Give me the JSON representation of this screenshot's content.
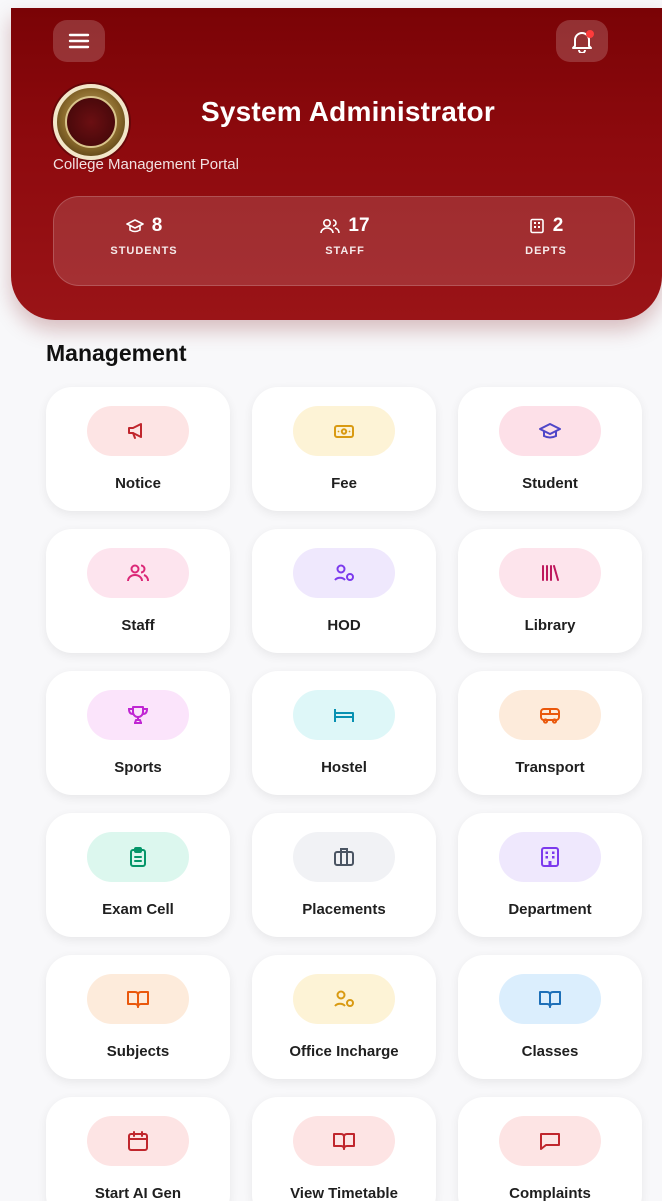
{
  "header": {
    "admin_name": "System Administrator",
    "portal_name": "College Management Portal",
    "menu_icon": "menu-icon",
    "notification_icon": "bell-icon",
    "logo": "college-logo"
  },
  "stats": [
    {
      "value": "8",
      "label": "STUDENTS",
      "icon": "graduation-cap-icon"
    },
    {
      "value": "17",
      "label": "STAFF",
      "icon": "users-icon"
    },
    {
      "value": "2",
      "label": "DEPTS",
      "icon": "building-icon"
    }
  ],
  "section": {
    "title": "Management"
  },
  "tiles": [
    {
      "label": "Notice",
      "icon": "megaphone-icon",
      "bg": "#fde4e4",
      "fg": "#c0262d"
    },
    {
      "label": "Fee",
      "icon": "banknote-icon",
      "bg": "#fdf3d6",
      "fg": "#d99a12"
    },
    {
      "label": "Student",
      "icon": "graduation-cap-icon",
      "bg": "#fde0e8",
      "fg": "#4f46c8"
    },
    {
      "label": "Staff",
      "icon": "users-icon",
      "bg": "#fde4ee",
      "fg": "#db2777"
    },
    {
      "label": "HOD",
      "icon": "user-cog-icon",
      "bg": "#efe8fd",
      "fg": "#7c3aed"
    },
    {
      "label": "Library",
      "icon": "library-icon",
      "bg": "#fde4ec",
      "fg": "#be185d"
    },
    {
      "label": "Sports",
      "icon": "trophy-icon",
      "bg": "#fbe4fb",
      "fg": "#c026d3"
    },
    {
      "label": "Hostel",
      "icon": "bed-icon",
      "bg": "#def7f8",
      "fg": "#0891b2"
    },
    {
      "label": "Transport",
      "icon": "bus-icon",
      "bg": "#fdebdb",
      "fg": "#ea580c"
    },
    {
      "label": "Exam Cell",
      "icon": "clipboard-icon",
      "bg": "#dcf7ee",
      "fg": "#059669"
    },
    {
      "label": "Placements",
      "icon": "briefcase-icon",
      "bg": "#f1f2f5",
      "fg": "#4b5563"
    },
    {
      "label": "Department",
      "icon": "building-icon",
      "bg": "#efe8fd",
      "fg": "#7c3aed"
    },
    {
      "label": "Subjects",
      "icon": "book-open-icon",
      "bg": "#fdebdb",
      "fg": "#ea580c"
    },
    {
      "label": "Office Incharge",
      "icon": "user-cog-icon",
      "bg": "#fdf3d6",
      "fg": "#d99a12"
    },
    {
      "label": "Classes",
      "icon": "book-open-icon",
      "bg": "#dbeefd",
      "fg": "#1d6fb8"
    },
    {
      "label": "Start AI Gen",
      "icon": "calendar-icon",
      "bg": "#fde4e4",
      "fg": "#c0262d"
    },
    {
      "label": "View Timetable",
      "icon": "book-open-icon",
      "bg": "#fde4e4",
      "fg": "#c0262d"
    },
    {
      "label": "Complaints",
      "icon": "message-square-icon",
      "bg": "#fde4e4",
      "fg": "#c0262d"
    }
  ]
}
